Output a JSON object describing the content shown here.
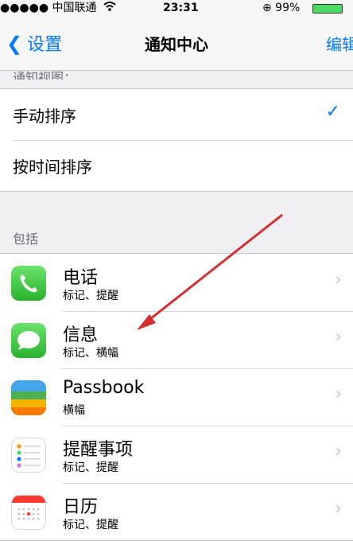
{
  "status_bar": {
    "carrier": "●●●●● 中国联通",
    "wifi_icon": "wifi-icon",
    "time": "23:31",
    "right_text": "⊕ 99%",
    "battery_icon": "battery-icon"
  },
  "nav": {
    "back_label": "设置",
    "title": "通知中心",
    "edit_label": "编辑"
  },
  "sort": {
    "partial_header": "通知视图：",
    "items": [
      {
        "label": "手动排序",
        "checked": true
      },
      {
        "label": "按时间排序",
        "checked": false
      }
    ]
  },
  "include": {
    "header": "包括",
    "apps": [
      {
        "name": "电话",
        "sub": "标记、提醒",
        "icon": "phone-icon"
      },
      {
        "name": "信息",
        "sub": "标记、横幅",
        "icon": "messages-icon"
      },
      {
        "name": "Passbook",
        "sub": "横幅",
        "icon": "passbook-icon"
      },
      {
        "name": "提醒事项",
        "sub": "标记、提醒",
        "icon": "reminders-icon"
      },
      {
        "name": "日历",
        "sub": "标记、提醒",
        "icon": "calendar-icon"
      }
    ]
  },
  "colors": {
    "accent": "#007aff",
    "arrow": "#d32f2f"
  }
}
